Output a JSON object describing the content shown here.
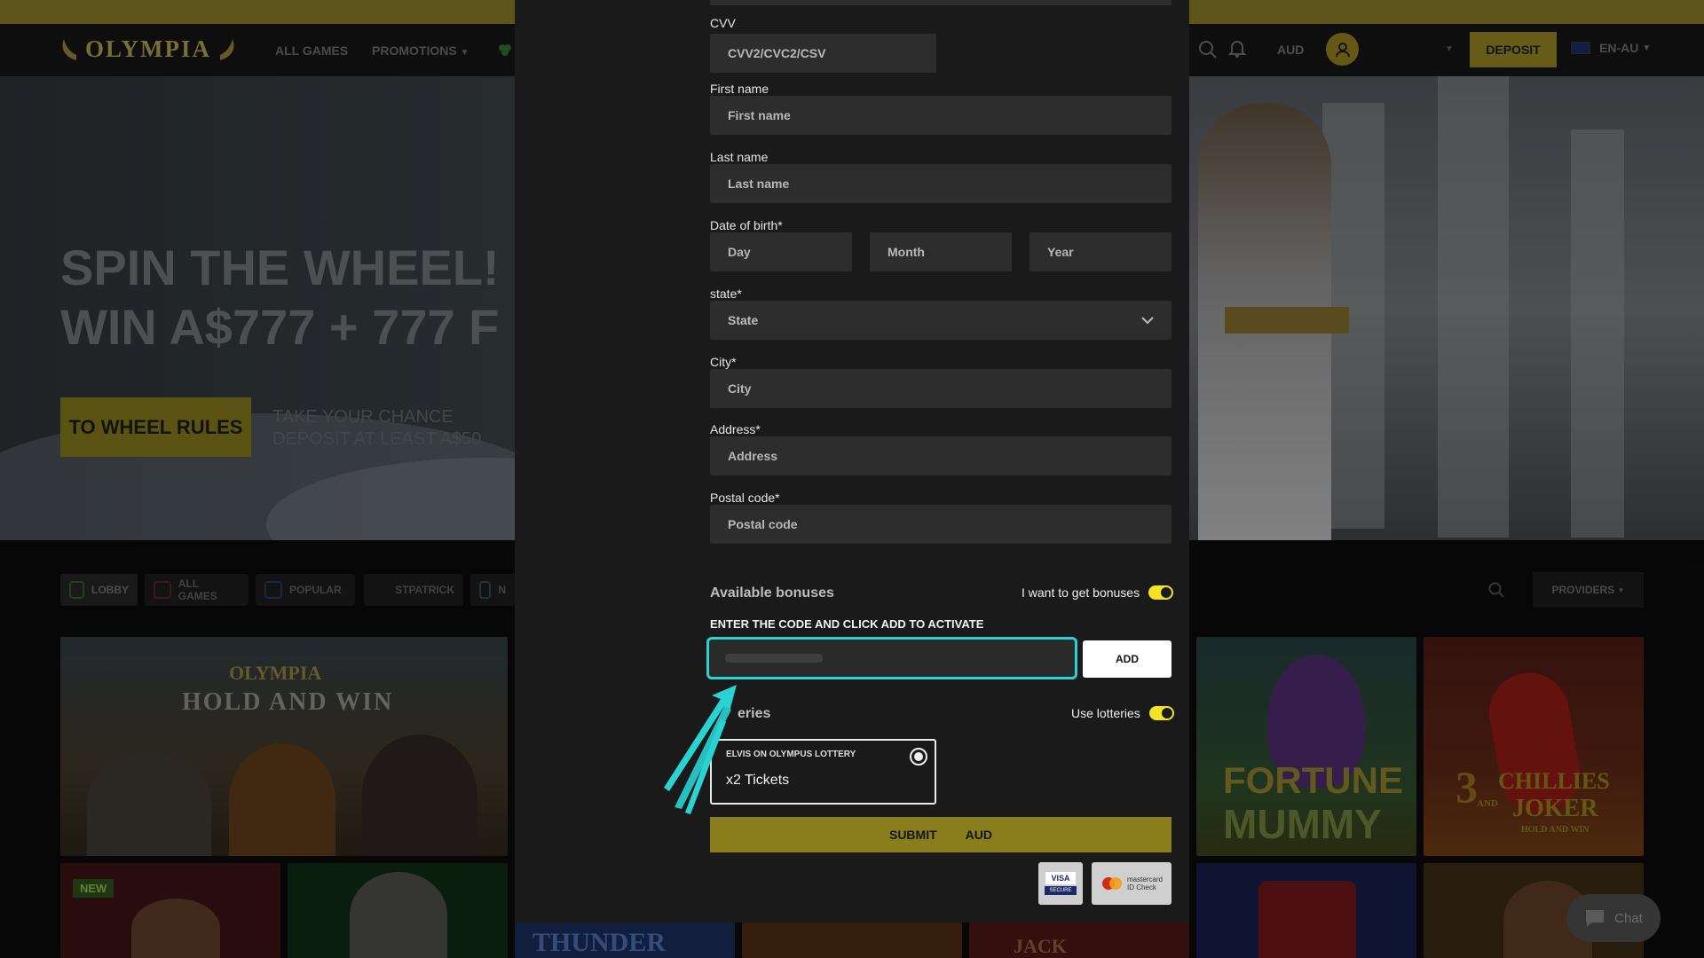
{
  "header": {
    "brand": "OLYMPIA",
    "nav": [
      "ALL GAMES",
      "PROMOTIONS"
    ],
    "currency": "AUD",
    "deposit_label": "DEPOSIT",
    "language": "EN-AU"
  },
  "hero": {
    "title_line1": "SPIN THE WHEEL!",
    "title_line2": "WIN A$777 + 777 F",
    "button_label": "TO WHEEL RULES",
    "sub_line1": "TAKE YOUR CHANCE",
    "sub_line2": "DEPOSIT AT LEAST A$50"
  },
  "categories": [
    "LOBBY",
    "ALL GAMES",
    "POPULAR",
    "STPATRICK",
    "N"
  ],
  "providers_label": "PROVIDERS",
  "games": {
    "hold_and_win_brand": "OLYMPIA",
    "hold_and_win_title": "HOLD AND WIN",
    "fortune_line1": "FORTUNE",
    "fortune_line2": "MUMMY",
    "chillies_line1": "CHILLIES",
    "chillies_line2": "JOKER",
    "chillies_num": "3",
    "chillies_and": "AND",
    "chillies_tag": "HOLD AND WIN",
    "new_badge": "NEW",
    "thunder": "THUNDER",
    "jack": "JACK"
  },
  "form": {
    "cvv_label": "CVV",
    "cvv_placeholder": "CVV2/CVC2/CSV",
    "first_name_label": "First name",
    "first_name_placeholder": "First name",
    "last_name_label": "Last name",
    "last_name_placeholder": "Last name",
    "dob_label": "Date of birth*",
    "day_placeholder": "Day",
    "month_placeholder": "Month",
    "year_placeholder": "Year",
    "state_label": "state*",
    "state_value": "State",
    "city_label": "City*",
    "city_placeholder": "City",
    "address_label": "Address*",
    "address_placeholder": "Address",
    "postal_label": "Postal code*",
    "postal_placeholder": "Postal code"
  },
  "bonuses": {
    "title": "Available bonuses",
    "toggle_label": "I want to get bonuses",
    "code_instruction": "ENTER THE CODE AND CLICK ADD TO ACTIVATE",
    "add_label": "ADD"
  },
  "lotteries": {
    "title": "eries",
    "toggle_label": "Use lotteries",
    "card_name": "ELVIS ON OLYMPUS LOTTERY",
    "card_value": "x2 Tickets"
  },
  "submit": {
    "label": "SUBMIT",
    "currency": "AUD"
  },
  "payments": {
    "visa_top": "VISA",
    "visa_bottom": "SECURE",
    "mc_line1": "mastercard",
    "mc_line2": "ID Check"
  },
  "chat_label": "Chat",
  "colors": {
    "accent": "#8c8120",
    "highlight": "#2ad3d3",
    "toggle": "#f2e324"
  }
}
